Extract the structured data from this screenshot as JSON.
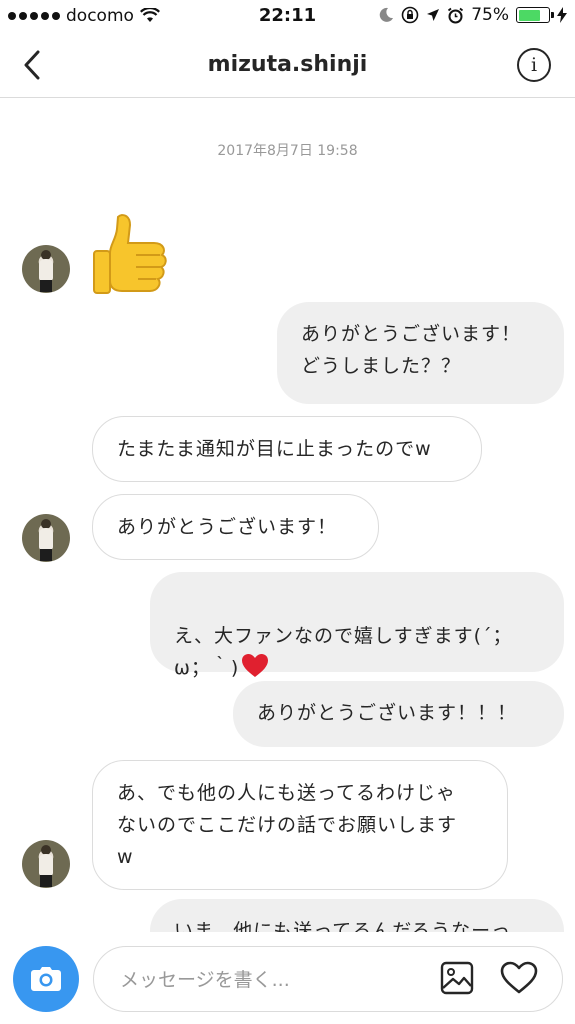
{
  "status_bar": {
    "carrier": "docomo",
    "time": "22:11",
    "battery_percent": "75%",
    "battery_level": 0.75,
    "signal_bars": 5
  },
  "header": {
    "title": "mizuta.shinji",
    "info_label": "i"
  },
  "chat": {
    "timestamp": "2017年8月7日 19:58",
    "messages": [
      {
        "from": "them",
        "type": "emoji",
        "icon": "thumbs-up-icon"
      },
      {
        "from": "me",
        "text": "ありがとうございます！\nどうしました？？"
      },
      {
        "from": "them",
        "text": "たまたま通知が目に止まったのでw"
      },
      {
        "from": "them",
        "text": "ありがとうございます！"
      },
      {
        "from": "me",
        "text": "え、大ファンなので嬉しすぎます(´；\nω；｀)"
      },
      {
        "from": "me",
        "text": "ありがとうございます！！！"
      },
      {
        "from": "them",
        "text": "あ、でも他の人にも送ってるわけじゃ\nないのでここだけの話でお願いします\nw"
      },
      {
        "from": "me",
        "text": "いま、他にも送ってるんだろうなーっ"
      }
    ]
  },
  "composer": {
    "placeholder": "メッセージを書く...",
    "camera_icon": "camera-icon",
    "gallery_icon": "image-icon",
    "like_icon": "heart-icon",
    "accent_color": "#3897f0"
  }
}
